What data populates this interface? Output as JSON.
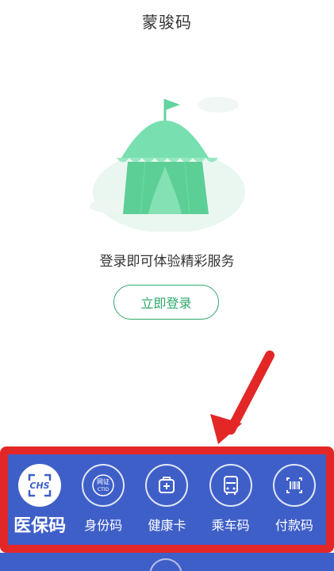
{
  "header": {
    "title": "蒙骏码"
  },
  "main": {
    "illustration": "tent-illustration",
    "message": "登录即可体验精彩服务",
    "login_button": "立即登录",
    "accent_color": "#2fa86b"
  },
  "annotation": {
    "arrow_color": "#e32727",
    "highlight_color": "#e32727"
  },
  "bottom_nav": {
    "background": "#3f5fc8",
    "items": [
      {
        "label": "医保码",
        "icon": "chs-icon",
        "icon_text": "CHS",
        "active": true
      },
      {
        "label": "身份码",
        "icon": "ctid-icon",
        "icon_text": "网证 CTID",
        "active": false
      },
      {
        "label": "健康卡",
        "icon": "health-kit-icon",
        "active": false
      },
      {
        "label": "乘车码",
        "icon": "bus-icon",
        "active": false
      },
      {
        "label": "付款码",
        "icon": "barcode-icon",
        "active": false
      }
    ]
  }
}
